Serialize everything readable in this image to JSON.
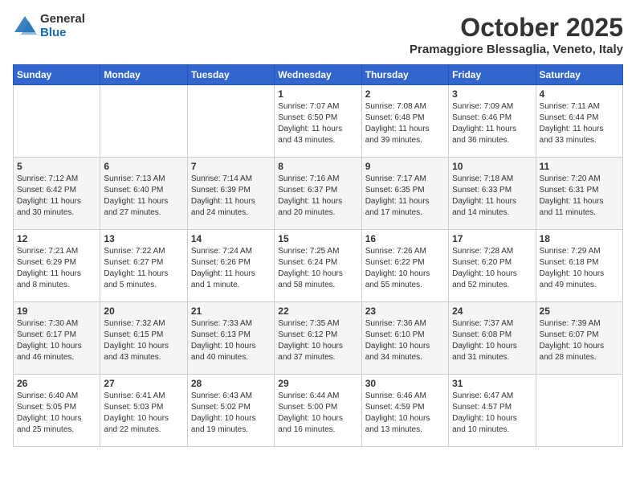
{
  "header": {
    "logo_general": "General",
    "logo_blue": "Blue",
    "month_title": "October 2025",
    "location": "Pramaggiore Blessaglia, Veneto, Italy"
  },
  "weekdays": [
    "Sunday",
    "Monday",
    "Tuesday",
    "Wednesday",
    "Thursday",
    "Friday",
    "Saturday"
  ],
  "weeks": [
    [
      {
        "day": "",
        "info": ""
      },
      {
        "day": "",
        "info": ""
      },
      {
        "day": "",
        "info": ""
      },
      {
        "day": "1",
        "info": "Sunrise: 7:07 AM\nSunset: 6:50 PM\nDaylight: 11 hours\nand 43 minutes."
      },
      {
        "day": "2",
        "info": "Sunrise: 7:08 AM\nSunset: 6:48 PM\nDaylight: 11 hours\nand 39 minutes."
      },
      {
        "day": "3",
        "info": "Sunrise: 7:09 AM\nSunset: 6:46 PM\nDaylight: 11 hours\nand 36 minutes."
      },
      {
        "day": "4",
        "info": "Sunrise: 7:11 AM\nSunset: 6:44 PM\nDaylight: 11 hours\nand 33 minutes."
      }
    ],
    [
      {
        "day": "5",
        "info": "Sunrise: 7:12 AM\nSunset: 6:42 PM\nDaylight: 11 hours\nand 30 minutes."
      },
      {
        "day": "6",
        "info": "Sunrise: 7:13 AM\nSunset: 6:40 PM\nDaylight: 11 hours\nand 27 minutes."
      },
      {
        "day": "7",
        "info": "Sunrise: 7:14 AM\nSunset: 6:39 PM\nDaylight: 11 hours\nand 24 minutes."
      },
      {
        "day": "8",
        "info": "Sunrise: 7:16 AM\nSunset: 6:37 PM\nDaylight: 11 hours\nand 20 minutes."
      },
      {
        "day": "9",
        "info": "Sunrise: 7:17 AM\nSunset: 6:35 PM\nDaylight: 11 hours\nand 17 minutes."
      },
      {
        "day": "10",
        "info": "Sunrise: 7:18 AM\nSunset: 6:33 PM\nDaylight: 11 hours\nand 14 minutes."
      },
      {
        "day": "11",
        "info": "Sunrise: 7:20 AM\nSunset: 6:31 PM\nDaylight: 11 hours\nand 11 minutes."
      }
    ],
    [
      {
        "day": "12",
        "info": "Sunrise: 7:21 AM\nSunset: 6:29 PM\nDaylight: 11 hours\nand 8 minutes."
      },
      {
        "day": "13",
        "info": "Sunrise: 7:22 AM\nSunset: 6:27 PM\nDaylight: 11 hours\nand 5 minutes."
      },
      {
        "day": "14",
        "info": "Sunrise: 7:24 AM\nSunset: 6:26 PM\nDaylight: 11 hours\nand 1 minute."
      },
      {
        "day": "15",
        "info": "Sunrise: 7:25 AM\nSunset: 6:24 PM\nDaylight: 10 hours\nand 58 minutes."
      },
      {
        "day": "16",
        "info": "Sunrise: 7:26 AM\nSunset: 6:22 PM\nDaylight: 10 hours\nand 55 minutes."
      },
      {
        "day": "17",
        "info": "Sunrise: 7:28 AM\nSunset: 6:20 PM\nDaylight: 10 hours\nand 52 minutes."
      },
      {
        "day": "18",
        "info": "Sunrise: 7:29 AM\nSunset: 6:18 PM\nDaylight: 10 hours\nand 49 minutes."
      }
    ],
    [
      {
        "day": "19",
        "info": "Sunrise: 7:30 AM\nSunset: 6:17 PM\nDaylight: 10 hours\nand 46 minutes."
      },
      {
        "day": "20",
        "info": "Sunrise: 7:32 AM\nSunset: 6:15 PM\nDaylight: 10 hours\nand 43 minutes."
      },
      {
        "day": "21",
        "info": "Sunrise: 7:33 AM\nSunset: 6:13 PM\nDaylight: 10 hours\nand 40 minutes."
      },
      {
        "day": "22",
        "info": "Sunrise: 7:35 AM\nSunset: 6:12 PM\nDaylight: 10 hours\nand 37 minutes."
      },
      {
        "day": "23",
        "info": "Sunrise: 7:36 AM\nSunset: 6:10 PM\nDaylight: 10 hours\nand 34 minutes."
      },
      {
        "day": "24",
        "info": "Sunrise: 7:37 AM\nSunset: 6:08 PM\nDaylight: 10 hours\nand 31 minutes."
      },
      {
        "day": "25",
        "info": "Sunrise: 7:39 AM\nSunset: 6:07 PM\nDaylight: 10 hours\nand 28 minutes."
      }
    ],
    [
      {
        "day": "26",
        "info": "Sunrise: 6:40 AM\nSunset: 5:05 PM\nDaylight: 10 hours\nand 25 minutes."
      },
      {
        "day": "27",
        "info": "Sunrise: 6:41 AM\nSunset: 5:03 PM\nDaylight: 10 hours\nand 22 minutes."
      },
      {
        "day": "28",
        "info": "Sunrise: 6:43 AM\nSunset: 5:02 PM\nDaylight: 10 hours\nand 19 minutes."
      },
      {
        "day": "29",
        "info": "Sunrise: 6:44 AM\nSunset: 5:00 PM\nDaylight: 10 hours\nand 16 minutes."
      },
      {
        "day": "30",
        "info": "Sunrise: 6:46 AM\nSunset: 4:59 PM\nDaylight: 10 hours\nand 13 minutes."
      },
      {
        "day": "31",
        "info": "Sunrise: 6:47 AM\nSunset: 4:57 PM\nDaylight: 10 hours\nand 10 minutes."
      },
      {
        "day": "",
        "info": ""
      }
    ]
  ]
}
